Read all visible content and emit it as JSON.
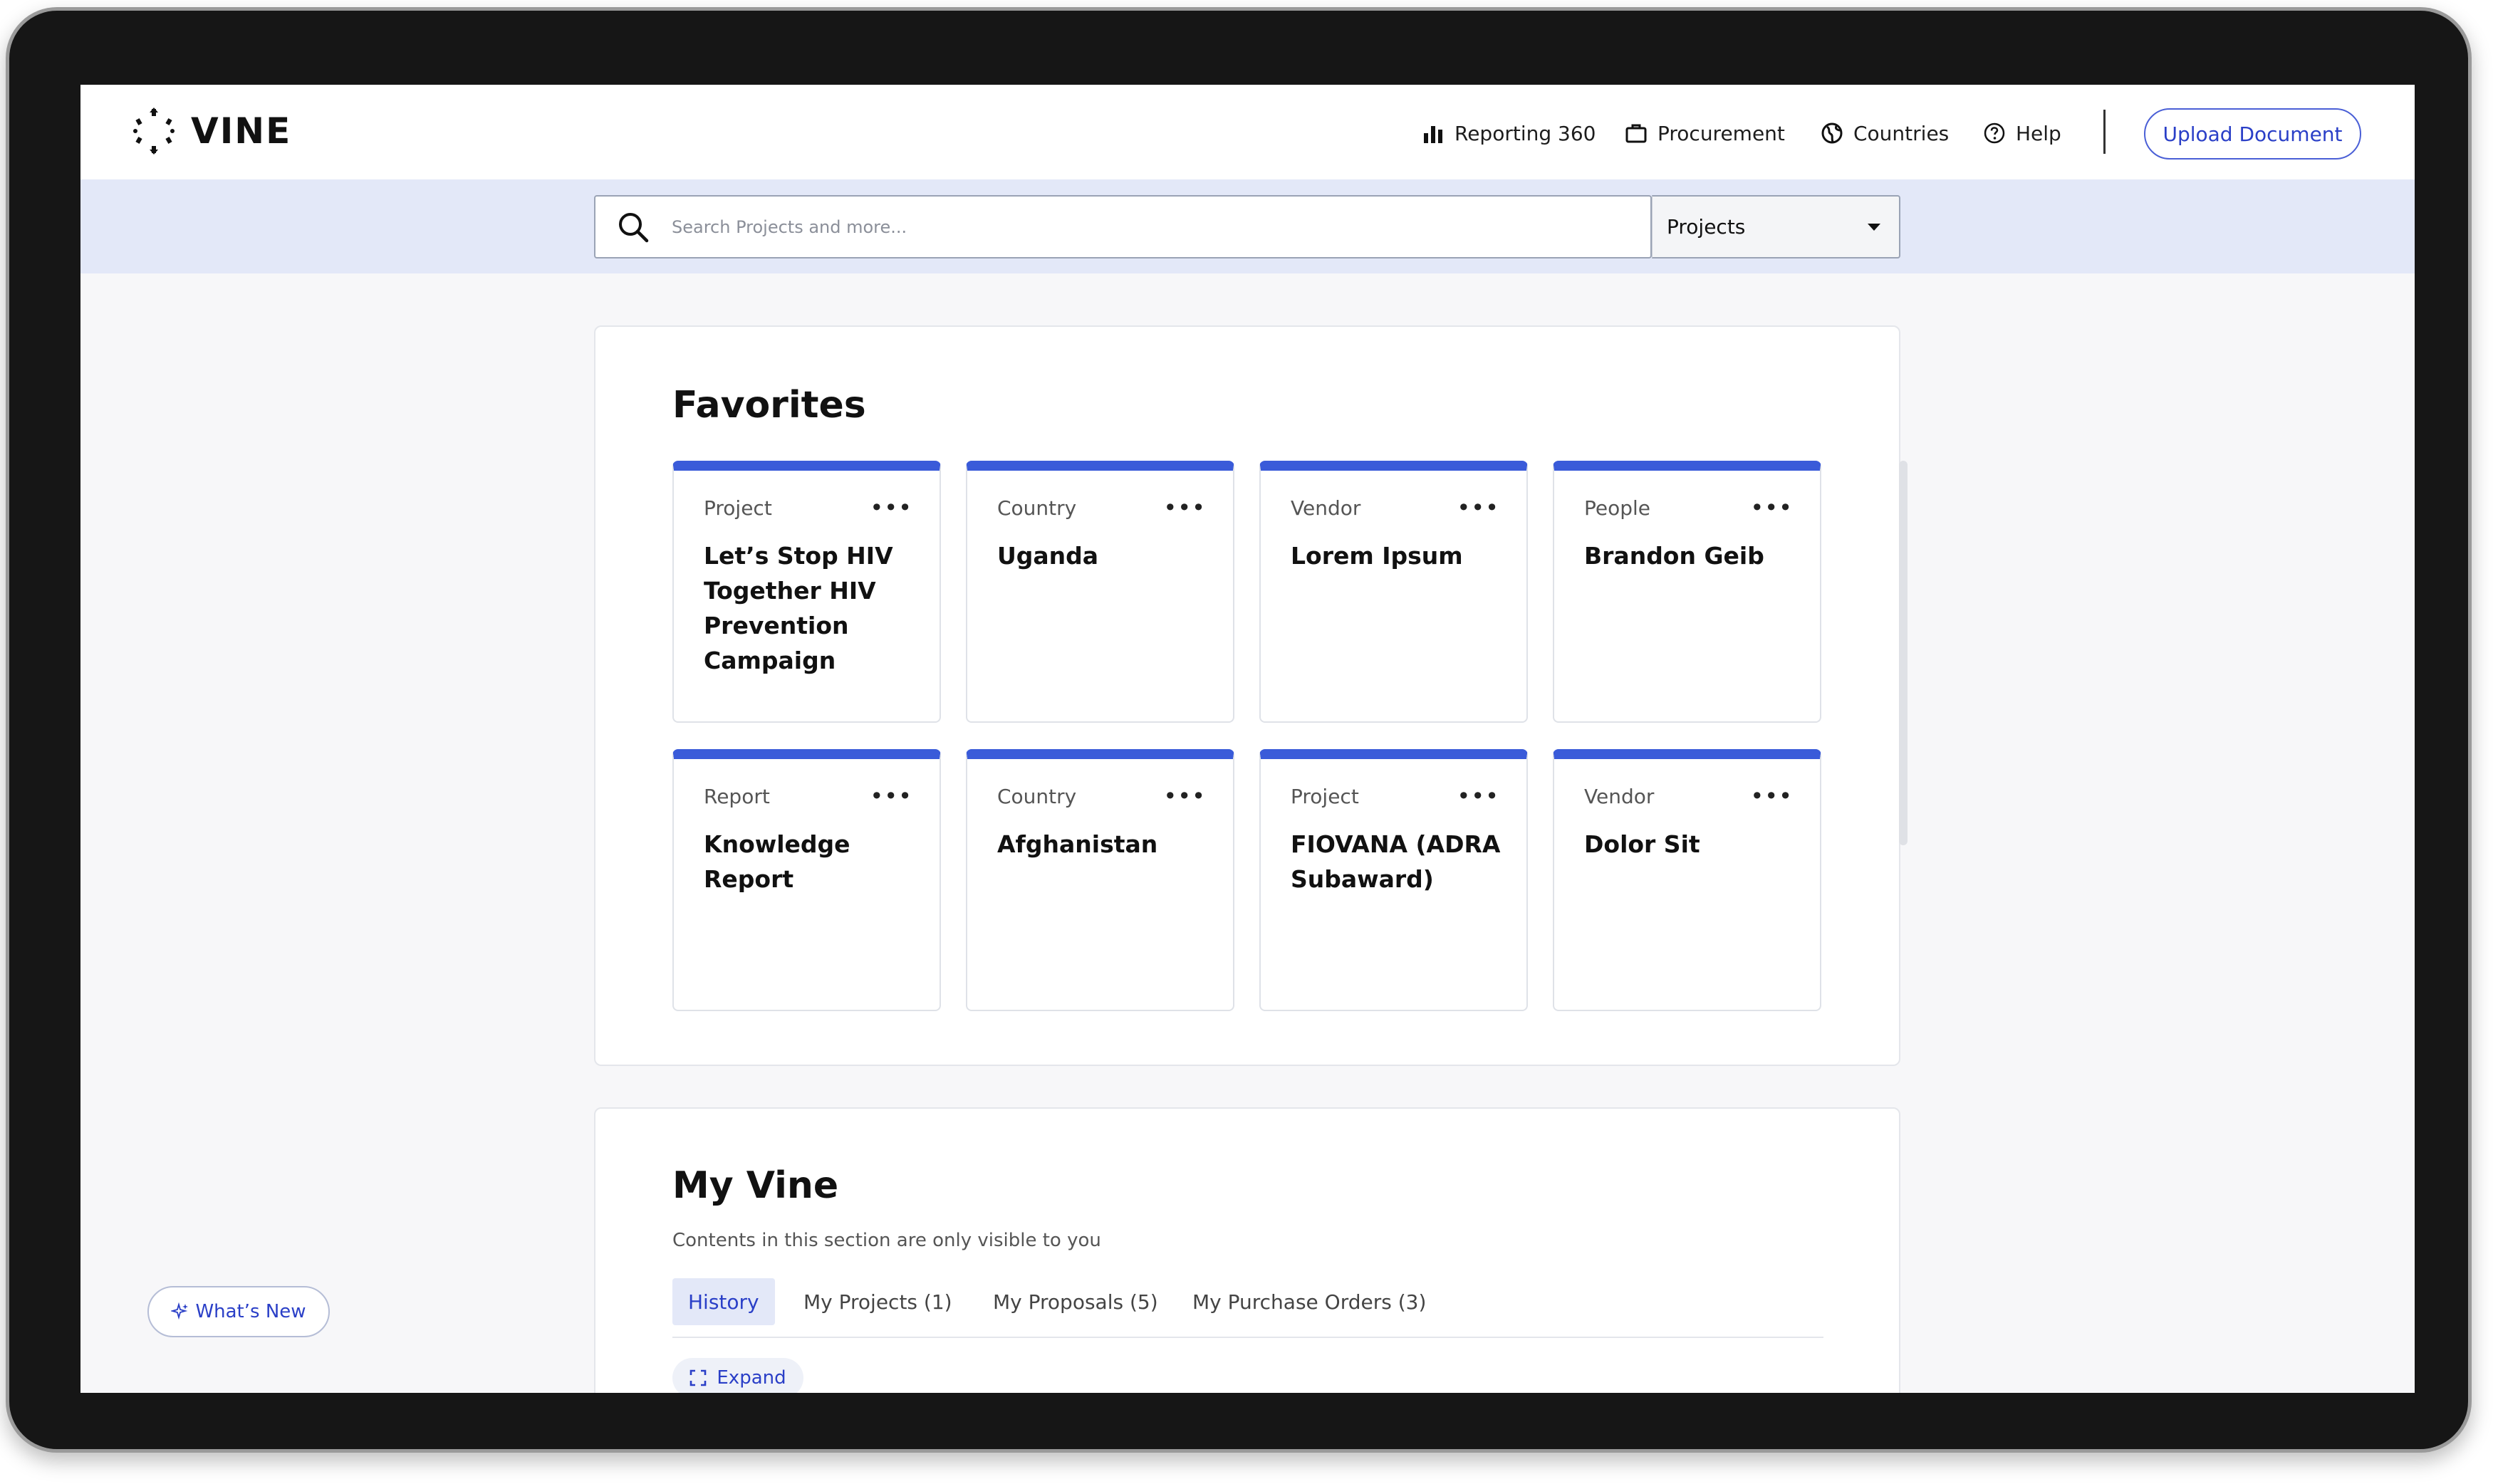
{
  "header": {
    "logo_text": "VINE",
    "nav": {
      "reporting": "Reporting 360",
      "procurement": "Procurement",
      "countries": "Countries",
      "help": "Help"
    },
    "upload_label": "Upload Document"
  },
  "search": {
    "placeholder": "Search Projects and more...",
    "value": "",
    "scope_selected": "Projects"
  },
  "favorites": {
    "title": "Favorites",
    "menu_glyph": "•••",
    "cards": [
      {
        "type": "Project",
        "title": "Let’s Stop HIV Together HIV Prevention Campaign"
      },
      {
        "type": "Country",
        "title": "Uganda"
      },
      {
        "type": "Vendor",
        "title": "Lorem Ipsum"
      },
      {
        "type": "People",
        "title": "Brandon Geib"
      },
      {
        "type": "Report",
        "title": "Knowledge Report"
      },
      {
        "type": "Country",
        "title": "Afghanistan"
      },
      {
        "type": "Project",
        "title": "FIOVANA (ADRA Subaward)"
      },
      {
        "type": "Vendor",
        "title": "Dolor Sit"
      }
    ]
  },
  "my_vine": {
    "title": "My Vine",
    "subtitle": "Contents in this section are only visible to you",
    "tabs": [
      "History",
      "My Projects (1)",
      "My Proposals (5)",
      "My Purchase Orders (3)"
    ],
    "active_tab": "History",
    "expand_label": "Expand"
  },
  "whats_new_label": "What’s New",
  "colors": {
    "accent": "#3a5bd9",
    "link": "#2a3fc7",
    "search_band": "#e3e8f8",
    "frame": "#161616"
  }
}
